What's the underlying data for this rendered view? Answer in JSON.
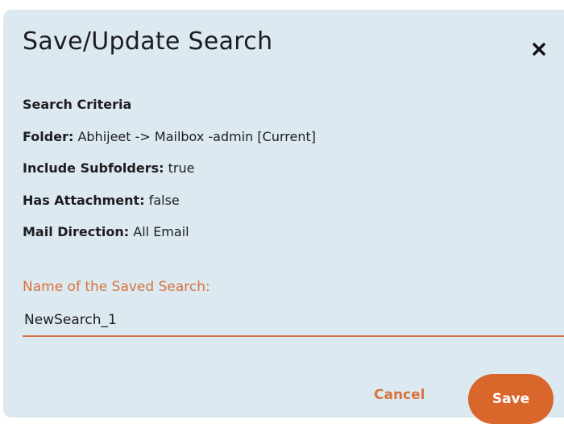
{
  "dialog": {
    "title": "Save/Update Search",
    "close_icon": "close-icon"
  },
  "criteria": {
    "heading": "Search Criteria",
    "rows": [
      {
        "label": "Folder:",
        "value": "Abhijeet  -> Mailbox -admin [Current]"
      },
      {
        "label": "Include Subfolders:",
        "value": "true"
      },
      {
        "label": "Has Attachment:",
        "value": "false"
      },
      {
        "label": "Mail Direction:",
        "value": "All Email"
      }
    ]
  },
  "name_field": {
    "label": "Name of the Saved Search:",
    "value": "NewSearch_1"
  },
  "buttons": {
    "cancel_label": "Cancel",
    "save_label": "Save"
  },
  "colors": {
    "dialog_bg": "#dde9f1",
    "accent": "#d9672c",
    "accent_text": "#d8723e",
    "text": "#1d1d1f"
  }
}
